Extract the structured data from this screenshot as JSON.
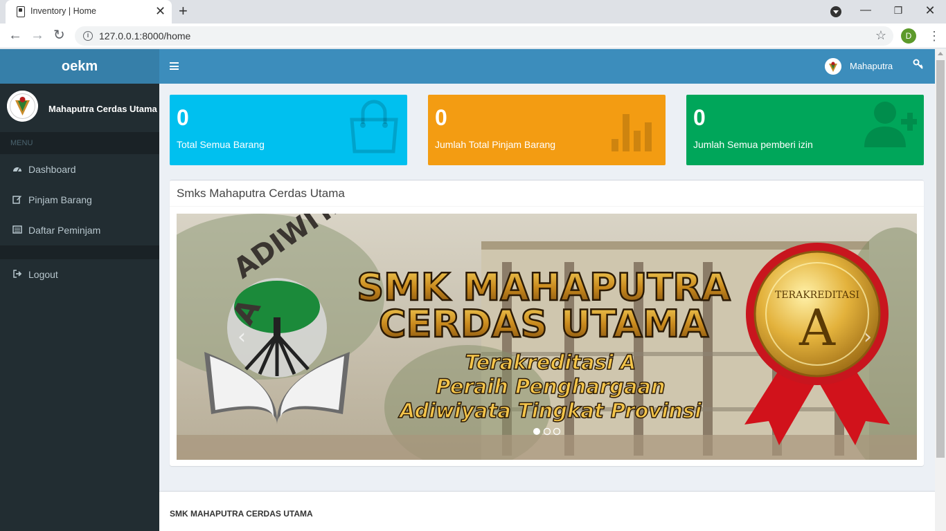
{
  "browser": {
    "tab_title": "Inventory | Home",
    "url": "127.0.0.1:8000/home",
    "profile_initial": "D"
  },
  "app": {
    "logo": "oekm",
    "user_name": "Mahaputra",
    "sidebar": {
      "user_name": "Mahaputra Cerdas Utama",
      "header": "MENU",
      "items": [
        {
          "label": "Dashboard",
          "icon": "dashboard-icon"
        },
        {
          "label": "Pinjam Barang",
          "icon": "edit-icon"
        },
        {
          "label": "Daftar Peminjam",
          "icon": "list-icon"
        },
        {
          "label": "Logout",
          "icon": "logout-icon"
        }
      ]
    },
    "stats": [
      {
        "value": "0",
        "label": "Total Semua Barang",
        "color": "#00c0ef",
        "icon": "shopping-bag-icon"
      },
      {
        "value": "0",
        "label": "Jumlah Total Pinjam Barang",
        "color": "#f39c12",
        "icon": "bar-chart-icon"
      },
      {
        "value": "0",
        "label": "Jumlah Semua pemberi izin",
        "color": "#00a65a",
        "icon": "user-add-icon"
      }
    ],
    "panel_title": "Smks Mahaputra Cerdas Utama",
    "banner": {
      "logo_text": "ADIWIYATA",
      "title_line1": "SMK MAHAPUTRA",
      "title_line2": "CERDAS UTAMA",
      "subtitle_line1": "Terakreditasi A",
      "subtitle_line2": "Peraih Penghargaan",
      "subtitle_line3": "Adiwiyata Tingkat Provinsi",
      "badge_top": "TERAKREDITASI",
      "badge_letter": "A",
      "slides": 3,
      "active_slide": 1
    },
    "footer_title": "SMK MAHAPUTRA CERDAS UTAMA"
  }
}
